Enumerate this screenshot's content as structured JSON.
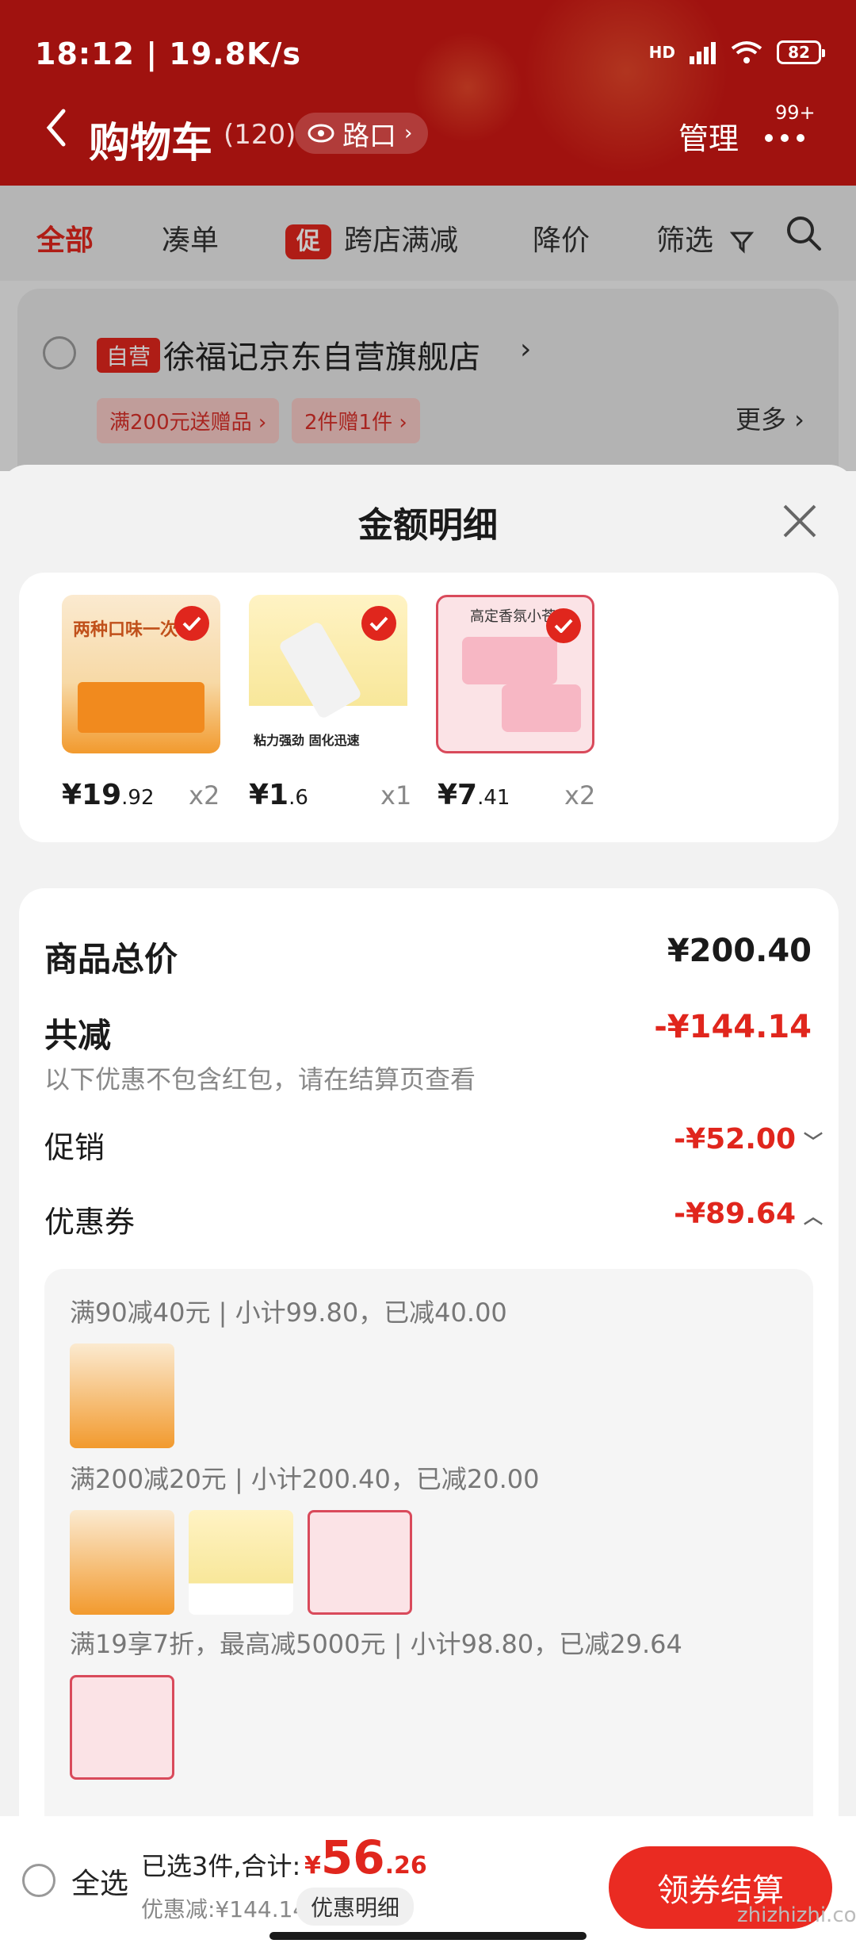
{
  "status": {
    "time": "18:12 | 19.8K/s",
    "battery": "82",
    "network": "HD"
  },
  "header": {
    "title": "购物车",
    "count": "(120)",
    "route": "路口",
    "manage": "管理",
    "badge": "99+"
  },
  "tabs": [
    {
      "label": "全部"
    },
    {
      "label": "凑单"
    },
    {
      "label": "跨店满减",
      "tag": "促"
    },
    {
      "label": "降价"
    },
    {
      "label": "筛选"
    }
  ],
  "store": {
    "self_tag": "自营",
    "name": "徐福记京东自营旗舰店",
    "chip1": "满200元送赠品 ›",
    "chip2": "2件赠1件 ›",
    "more": "更多 ›"
  },
  "sheet": {
    "title": "金额明细"
  },
  "products": [
    {
      "price_int": "¥19",
      "price_dec": ".92",
      "qty": "x2",
      "img_text": "两种口味一次"
    },
    {
      "price_int": "¥1",
      "price_dec": ".6",
      "qty": "x1",
      "img_text": "粘力强劲 固化迅速"
    },
    {
      "price_int": "¥7",
      "price_dec": ".41",
      "qty": "x2",
      "img_text": "高定香氛小苍兰"
    }
  ],
  "summary": {
    "total_label": "商品总价",
    "total_value": "¥200.40",
    "minus_label": "共减",
    "minus_value": "-¥144.14",
    "note": "以下优惠不包含红包，请在结算页查看",
    "promo_label": "促销",
    "promo_value": "-¥52.00",
    "coupon_label": "优惠券",
    "coupon_value": "-¥89.64"
  },
  "coupons": [
    {
      "title": "满90减40元 | 小计99.80，已减40.00"
    },
    {
      "title": "满200减20元 | 小计200.40，已减20.00"
    },
    {
      "title": "满19享7折，最高减5000元 | 小计98.80，已减29.64"
    }
  ],
  "bottom": {
    "select_all": "全选",
    "selected": "已选3件,合计:",
    "currency": "¥",
    "price_int": "56",
    "price_dec": ".26",
    "discount": "优惠减:¥144.14",
    "detail": "优惠明细",
    "checkout": "领券结算"
  },
  "watermark": "zhizhizhi.com",
  "colors": {
    "brand_red": "#e0261d",
    "header_bg": "#a0120f"
  }
}
